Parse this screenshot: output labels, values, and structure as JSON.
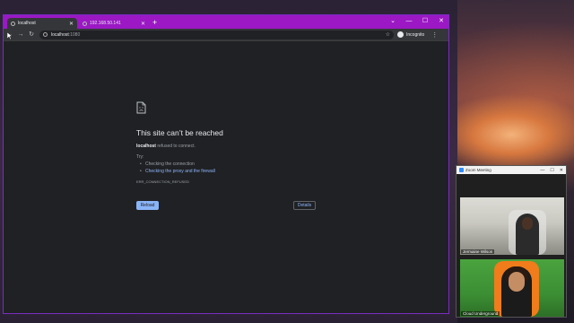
{
  "browser": {
    "tabs": [
      {
        "title": "localhost",
        "active": true
      },
      {
        "title": "192.168.50.141",
        "active": false
      }
    ],
    "new_tab_glyph": "+",
    "url_host": "localhost",
    "url_port": ":1080",
    "profile_label": "Incognito",
    "window_controls": [
      "⌄",
      "—",
      "☐",
      "✕"
    ],
    "accent_color": "#9b18c4"
  },
  "error_page": {
    "title": "This site can’t be reached",
    "host": "localhost",
    "description_suffix": " refused to connect.",
    "try_label": "Try:",
    "suggestions": [
      "Checking the connection",
      "Checking the proxy and the firewall"
    ],
    "error_code": "ERR_CONNECTION_REFUSED",
    "reload_label": "Reload",
    "details_label": "Details",
    "link_color": "#8ab4f8"
  },
  "zoom": {
    "window_title": "Zoom Meeting",
    "participants": [
      {
        "name": "Jermaine Wilson"
      },
      {
        "name": "Cloud Underground"
      }
    ]
  }
}
